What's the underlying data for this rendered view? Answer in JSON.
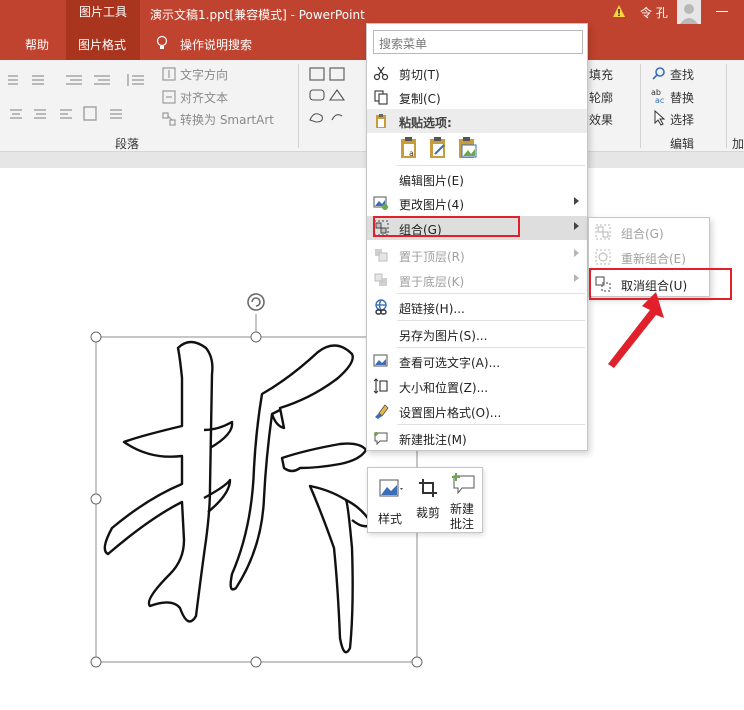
{
  "titlebar": {
    "tool_context": "图片工具",
    "doc_title": "演示文稿1.ppt[兼容模式] - PowerPoint",
    "user_name": "令 孔",
    "tabs": [
      "帮助",
      "图片格式"
    ],
    "tell_me": "操作说明搜索"
  },
  "ribbon": {
    "text_direction": "文字方向",
    "align_text": "对齐文本",
    "convert_smartart": "转换为 SmartArt",
    "paragraph_group": "段落",
    "fill": "填充",
    "outline": "轮廓",
    "effects": "效果",
    "find": "查找",
    "replace": "替换",
    "select": "选择",
    "editing_group": "编辑",
    "cut_off_group": "加"
  },
  "context_menu": {
    "search_placeholder": "搜索菜单",
    "cut": "剪切(T)",
    "copy": "复制(C)",
    "paste_options": "粘贴选项:",
    "edit_picture": "编辑图片(E)",
    "change_picture": "更改图片(4)",
    "group": "组合(G)",
    "bring_to_front": "置于顶层(R)",
    "send_to_back": "置于底层(K)",
    "hyperlink": "超链接(H)...",
    "save_as_picture": "另存为图片(S)...",
    "view_alt_text": "查看可选文字(A)...",
    "size_position": "大小和位置(Z)...",
    "format_picture": "设置图片格式(O)...",
    "new_comment": "新建批注(M)"
  },
  "submenu": {
    "group": "组合(G)",
    "regroup": "重新组合(E)",
    "ungroup": "取消组合(U)"
  },
  "mini_toolbar": {
    "style": "样式",
    "crop": "裁剪",
    "new_comment_line1": "新建",
    "new_comment_line2": "批注"
  },
  "colors": {
    "accent": "#c0432f",
    "highlight_box": "#e0202a",
    "arrow": "#e0202a"
  }
}
